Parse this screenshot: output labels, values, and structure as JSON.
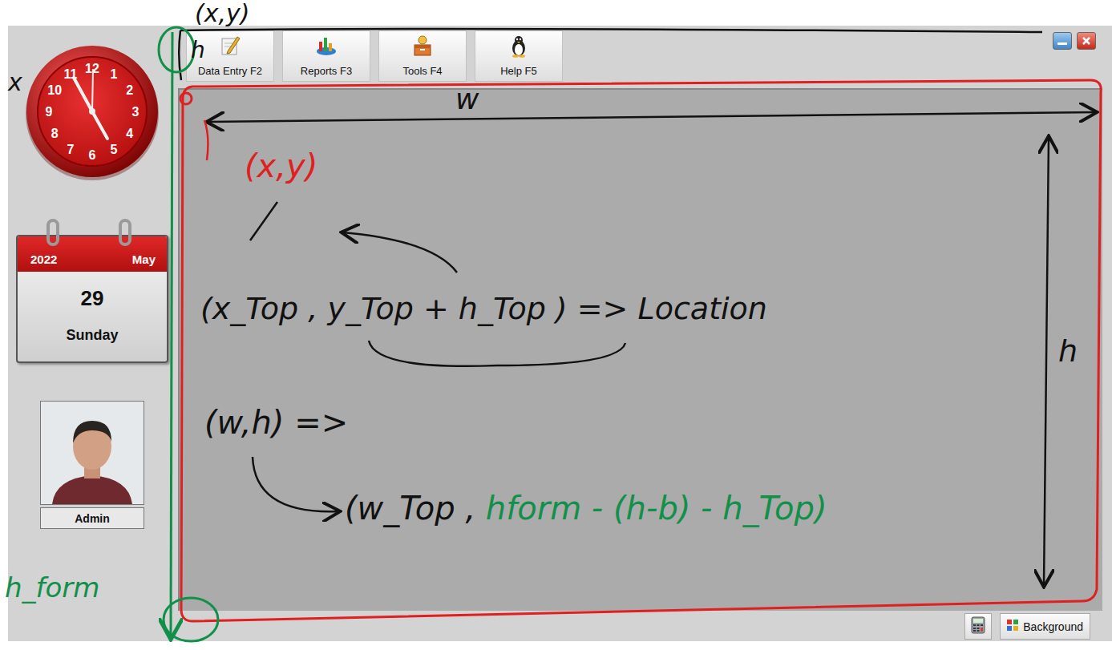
{
  "toolbar": [
    {
      "label": "Data Entry F2"
    },
    {
      "label": "Reports F3"
    },
    {
      "label": "Tools F4"
    },
    {
      "label": "Help F5"
    }
  ],
  "clock": {
    "numbers": [
      "12",
      "1",
      "2",
      "3",
      "4",
      "5",
      "6",
      "7",
      "8",
      "9",
      "10",
      "11"
    ]
  },
  "calendar": {
    "year": "2022",
    "month": "May",
    "day": "29",
    "weekday": "Sunday"
  },
  "user": {
    "name": "Admin"
  },
  "bottom_buttons": [
    {
      "label": "Background"
    }
  ],
  "annotations": [
    {
      "segments": [
        {
          "text": "(x,y)",
          "color": "#111111"
        }
      ]
    },
    {
      "segments": [
        {
          "text": "h",
          "color": "#111111"
        }
      ]
    },
    {
      "segments": [
        {
          "text": "x",
          "color": "#111111"
        }
      ]
    },
    {
      "segments": [
        {
          "text": "w",
          "color": "#111111"
        }
      ]
    },
    {
      "segments": [
        {
          "text": "(x,y)",
          "color": "#e02020"
        }
      ]
    },
    {
      "segments": [
        {
          "text": "(x_Top , y_Top + h_Top ) => Location",
          "color": "#111111"
        }
      ]
    },
    {
      "segments": [
        {
          "text": "(w,h) =>",
          "color": "#111111"
        }
      ]
    },
    {
      "segments": [
        {
          "text": "(w_Top , ",
          "color": "#111111"
        },
        {
          "text": "hform - (h-b) - h_Top)",
          "color": "#12904a"
        }
      ]
    },
    {
      "segments": [
        {
          "text": "h",
          "color": "#111111"
        }
      ]
    },
    {
      "segments": [
        {
          "text": "h_form",
          "color": "#12904a"
        }
      ]
    }
  ]
}
